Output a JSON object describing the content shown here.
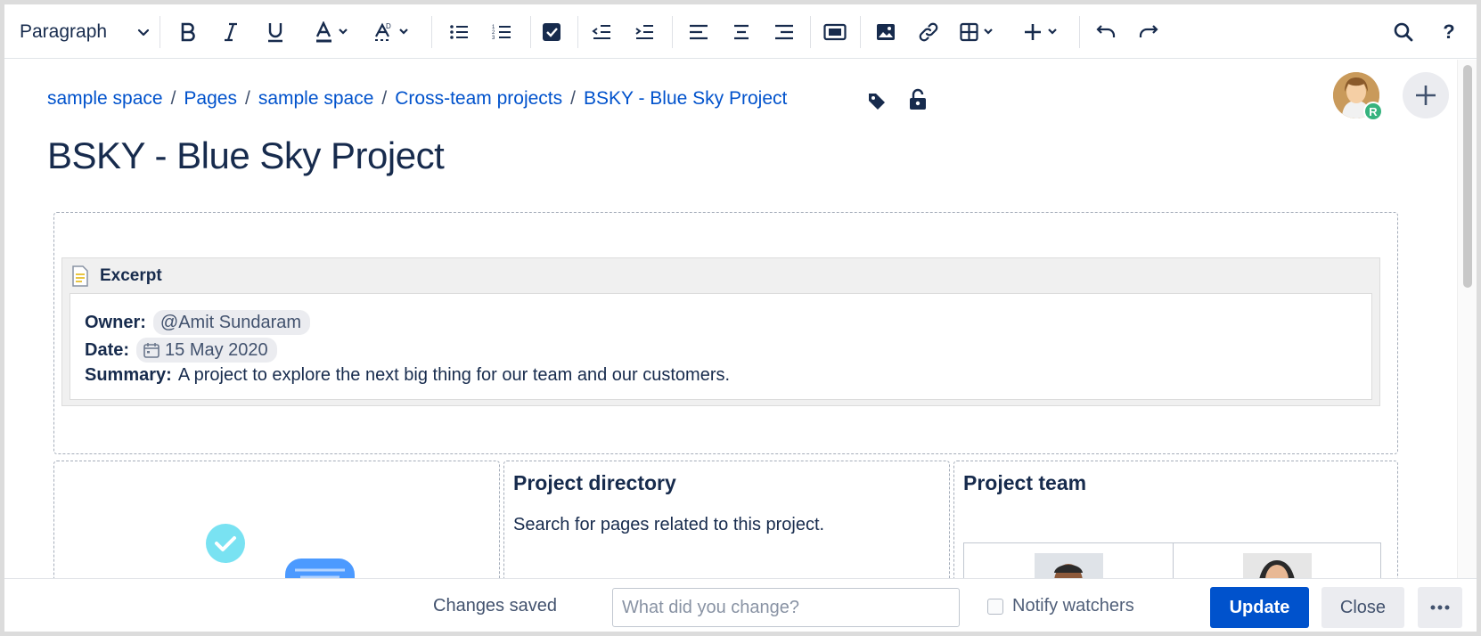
{
  "toolbar": {
    "paragraph_label": "Paragraph",
    "icons": [
      "bold-icon",
      "italic-icon",
      "underline-icon",
      "text-color-icon",
      "clear-format-icon",
      "bullet-list-icon",
      "numbered-list-icon",
      "task-icon",
      "outdent-icon",
      "indent-icon",
      "align-left-icon",
      "align-center-icon",
      "align-right-icon",
      "layout-icon",
      "image-icon",
      "link-icon",
      "table-icon",
      "insert-icon",
      "undo-icon",
      "redo-icon",
      "search-icon",
      "help-icon"
    ],
    "help_label": "?"
  },
  "breadcrumb": {
    "items": [
      "sample space",
      "Pages",
      "sample space",
      "Cross-team projects",
      "BSKY - Blue Sky Project"
    ],
    "separator": "/"
  },
  "page": {
    "title": "BSKY - Blue Sky Project"
  },
  "avatar": {
    "badge": "R"
  },
  "excerpt": {
    "header": "Excerpt",
    "owner_label": "Owner:",
    "owner_mention": "@Amit Sundaram",
    "date_label": "Date:",
    "date_value": "15 May 2020",
    "summary_label": "Summary:",
    "summary_text": "A project to explore the next big thing for our team and our customers."
  },
  "directory": {
    "title": "Project directory",
    "text": "Search for pages related to this project."
  },
  "team": {
    "title": "Project team"
  },
  "footer": {
    "status": "Changes saved",
    "change_placeholder": "What did you change?",
    "notify_label": "Notify watchers",
    "update_label": "Update",
    "close_label": "Close",
    "more_label": "···"
  },
  "colors": {
    "accent": "#0052cc",
    "text": "#172b4d",
    "badge": "#36b37e"
  }
}
